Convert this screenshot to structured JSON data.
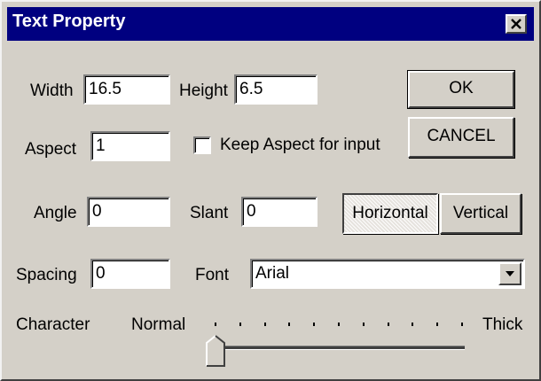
{
  "window": {
    "title": "Text Property",
    "close_icon": "close-x-icon"
  },
  "fields": {
    "width": {
      "label": "Width",
      "value": "16.5"
    },
    "height": {
      "label": "Height",
      "value": "6.5"
    },
    "aspect": {
      "label": "Aspect",
      "value": "1"
    },
    "angle": {
      "label": "Angle",
      "value": "0"
    },
    "slant": {
      "label": "Slant",
      "value": "0"
    },
    "spacing": {
      "label": "Spacing",
      "value": "0"
    }
  },
  "keep_aspect": {
    "label": "Keep Aspect for input",
    "checked": false
  },
  "buttons": {
    "ok": "OK",
    "cancel": "CANCEL",
    "horizontal": "Horizontal",
    "vertical": "Vertical"
  },
  "orientation_selected": "Horizontal",
  "font": {
    "label": "Font",
    "selected": "Arial",
    "dropdown_icon": "chevron-down-icon"
  },
  "character": {
    "label": "Character",
    "min_label": "Normal",
    "max_label": "Thick",
    "ticks": 11,
    "value_fraction": 0
  },
  "colors": {
    "titlebar": "#000080",
    "dialog_face": "#d4d0c8",
    "field_background": "#ffffff"
  }
}
